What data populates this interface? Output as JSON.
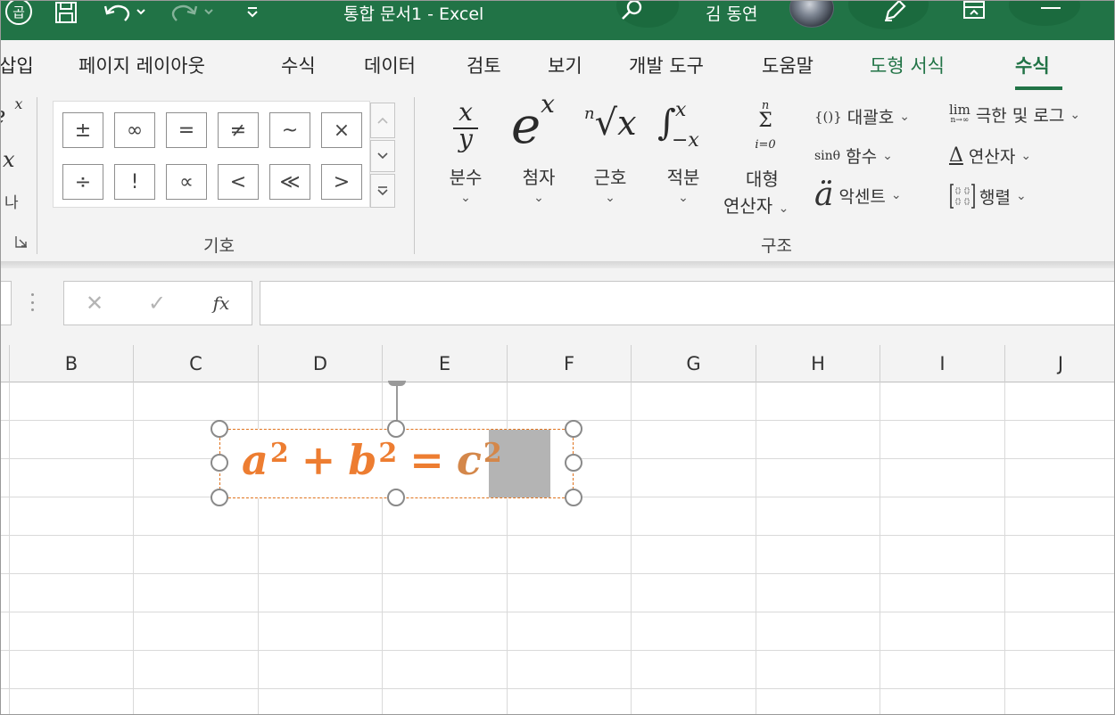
{
  "titlebar": {
    "left_icon_glyph": "곱",
    "title": "통합 문서1  -  Excel",
    "user": "김 동연"
  },
  "ribbon_tabs": [
    "삽입",
    "페이지 레이아웃",
    "수식",
    "데이터",
    "검토",
    "보기",
    "개발 도구",
    "도움말",
    "도형 서식",
    "수식"
  ],
  "symbols": {
    "row1": [
      "±",
      "∞",
      "=",
      "≠",
      "~",
      "×"
    ],
    "row2": [
      "÷",
      "!",
      "∝",
      "<",
      "≪",
      ">"
    ],
    "group_label": "기호"
  },
  "left_partial": {
    "label": "나"
  },
  "structures": {
    "group_label": "구조",
    "fraction": {
      "label": "분수",
      "num": "x",
      "den": "y"
    },
    "script": {
      "label": "첨자",
      "base": "e",
      "sup": "x"
    },
    "radical": {
      "label": "근호",
      "index": "n",
      "radicand": "x"
    },
    "integral": {
      "label": "적분",
      "upper": "x",
      "lower": "−x"
    },
    "large_operator": {
      "label1": "대형",
      "label2": "연산자",
      "top": "n",
      "sym": "Σ",
      "bottom": "i=0"
    },
    "bracket": {
      "icon_text": "{()}",
      "label": "대괄호"
    },
    "function": {
      "icon_text": "sinθ",
      "label": "함수"
    },
    "accent": {
      "icon_text": "ä",
      "label": "악센트"
    },
    "limit": {
      "icon_text": "lim",
      "icon_sub": "n→∞",
      "label": "극한 및 로그"
    },
    "operator": {
      "icon_text": "Δ",
      "label": "연산자"
    },
    "matrix": {
      "label": "행렬"
    }
  },
  "formula_bar": {
    "cancel": "✕",
    "enter": "✓",
    "fx": "fx"
  },
  "columns": [
    "B",
    "C",
    "D",
    "E",
    "F",
    "G",
    "H",
    "I",
    "J"
  ],
  "equation": {
    "a": "a",
    "b": "b",
    "c": "c",
    "exp": "2",
    "plus": "+",
    "equals": "=",
    "color": "#ed7d31"
  },
  "colors": {
    "excel_green": "#217346",
    "ribbon_bg": "#f3f3f3",
    "selection_gray": "#b4b4b4"
  }
}
